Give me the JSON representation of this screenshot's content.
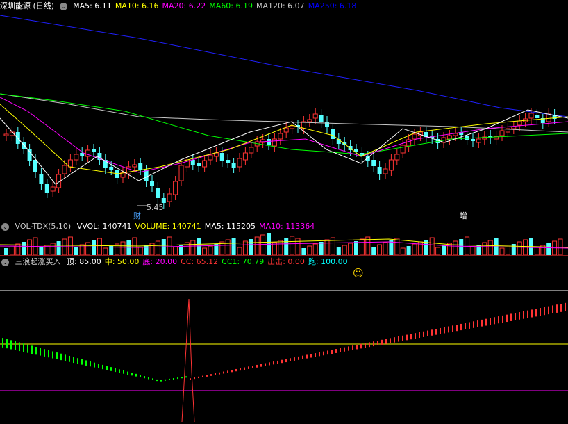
{
  "header": {
    "stock": "深圳能源 (日线)",
    "ma": [
      {
        "label": "MA5: 6.11",
        "color": "#ffffff"
      },
      {
        "label": "MA10: 6.16",
        "color": "#ffff00"
      },
      {
        "label": "MA20: 6.22",
        "color": "#ff00ff"
      },
      {
        "label": "MA60: 6.19",
        "color": "#00ff00"
      },
      {
        "label": "MA120: 6.07",
        "color": "#c8c8c8"
      },
      {
        "label": "MA250: 6.18",
        "color": "#0000ff"
      }
    ]
  },
  "price_panel": {
    "low_label": "5.45",
    "marker_cai": "财",
    "marker_zeng": "增"
  },
  "volume_header": {
    "name": "VOL-TDX(5,10)",
    "items": [
      {
        "label": "VVOL: 140741",
        "color": "#ffffff"
      },
      {
        "label": "VOLUME: 140741",
        "color": "#ffff00"
      },
      {
        "label": "MA5: 115205",
        "color": "#ffffff"
      },
      {
        "label": "MA10: 113364",
        "color": "#ff00ff"
      }
    ]
  },
  "indicator_header": {
    "name": "三浪起涨买入",
    "items": [
      {
        "label": "顶: 85.00",
        "color": "#ffffff"
      },
      {
        "label": "中: 50.00",
        "color": "#ffff00"
      },
      {
        "label": "底: 20.00",
        "color": "#ff00ff"
      },
      {
        "label": "CC: 65.12",
        "color": "#ff3333"
      },
      {
        "label": "CC1: 70.79",
        "color": "#00ff00"
      },
      {
        "label": "出击: 0.00",
        "color": "#ff3333"
      },
      {
        "label": "跑: 100.00",
        "color": "#00ffff"
      }
    ],
    "smiley": "☺"
  },
  "colors": {
    "up": "#ff3333",
    "down": "#54ffff",
    "grid": "#8b1a1a"
  }
}
